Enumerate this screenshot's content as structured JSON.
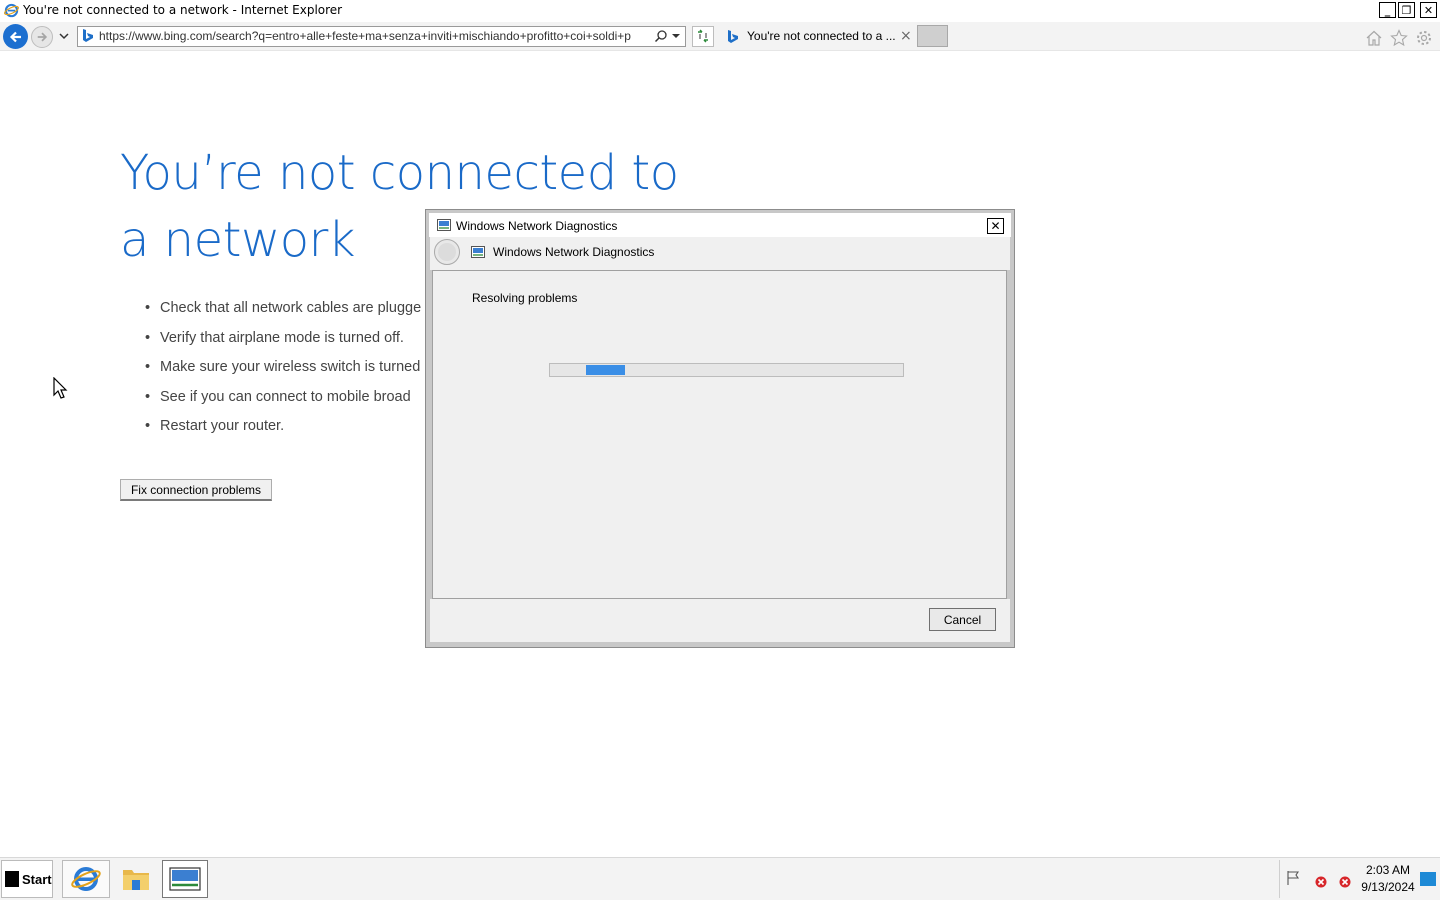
{
  "window": {
    "title": "You're not connected to a network - Internet Explorer",
    "minimize": "_",
    "maximize": "❐",
    "close": "✕"
  },
  "navbar": {
    "address": "https://www.bing.com/search?q=entro+alle+feste+ma+senza+inviti+mischiando+profitto+coi+soldi+p",
    "tab_title": "You're not connected to a ...",
    "tab_close": "×",
    "icons": [
      "back-icon",
      "forward-icon",
      "bing-icon",
      "search-icon",
      "compatibility-icon",
      "home-icon",
      "favorites-icon",
      "tools-icon"
    ]
  },
  "page": {
    "headline": "You’re not connected to a network",
    "tips": [
      "Check that all network cables are plugge",
      "Verify that airplane mode is turned off.",
      "Make sure your wireless switch is turned",
      "See if you can connect to mobile broad",
      "Restart your router."
    ],
    "bullet": "•",
    "fix_button": "Fix connection problems"
  },
  "dialog": {
    "title": "Windows Network Diagnostics",
    "header": "Windows Network Diagnostics",
    "status": "Resolving problems",
    "close": "✕",
    "cancel": "Cancel",
    "progress_indeterminate": true
  },
  "taskbar": {
    "start_label": "Start",
    "time": "2:03 AM",
    "date": "9/13/2024",
    "apps": [
      "internet-explorer-icon",
      "file-explorer-icon",
      "network-diagnostics-icon"
    ]
  },
  "colors": {
    "headline_blue": "#1a6ac8",
    "progress_blue": "#3a8ee6",
    "back_button_blue": "#1c6fd0",
    "tray_error_red": "#d7262a"
  }
}
